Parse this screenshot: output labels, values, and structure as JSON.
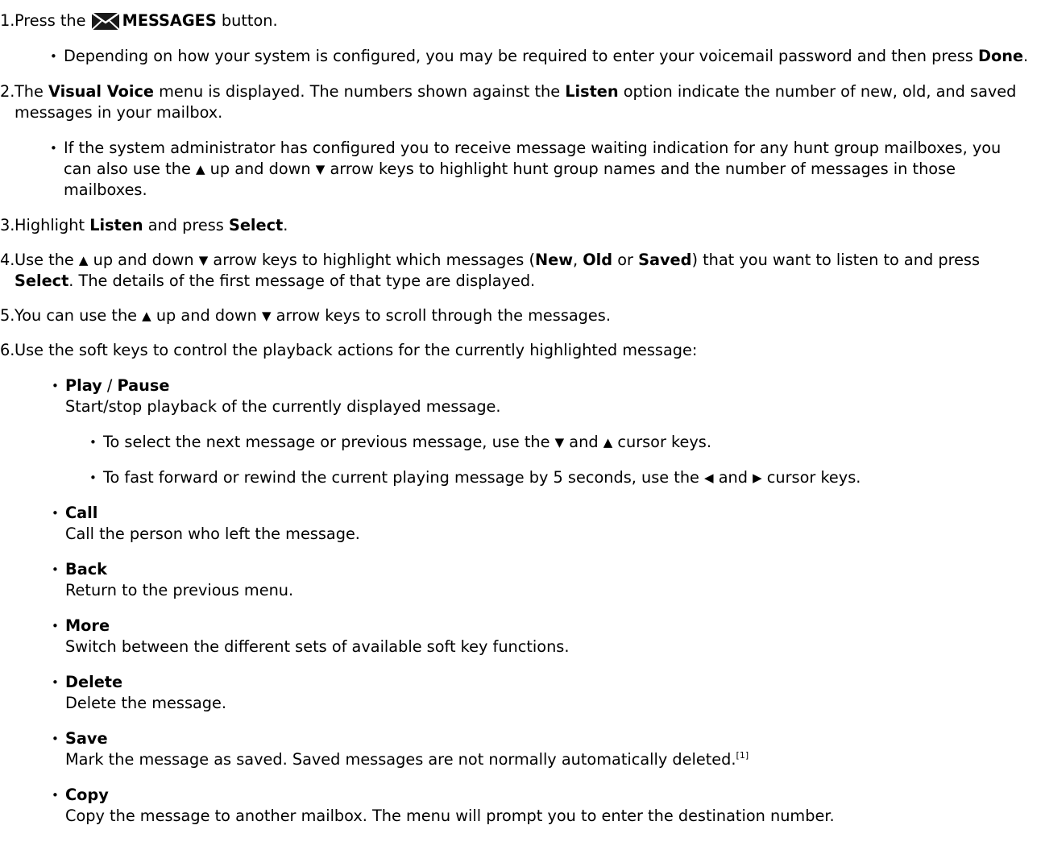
{
  "step1": {
    "num": "1.",
    "pre": "Press the ",
    "key": "MESSAGES",
    "post": " button.",
    "sub": {
      "pre": "Depending on how your system is configured, you may be required to enter your voicemail password and then press ",
      "key": "Done",
      "post": "."
    }
  },
  "step2": {
    "num": "2.",
    "a": "The ",
    "b": "Visual Voice",
    "c": " menu is displayed. The numbers shown against the ",
    "d": "Listen",
    "e": " option indicate the number of new, old, and saved messages in your mailbox.",
    "sub": {
      "a": "If the system administrator has configured you to receive message waiting indication for any hunt group mailboxes, you can also use the ",
      "b": " up and down ",
      "c": " arrow keys to highlight hunt group names and the number of messages in those mailboxes."
    }
  },
  "step3": {
    "num": "3.",
    "a": "Highlight ",
    "b": "Listen",
    "c": " and press ",
    "d": "Select",
    "e": "."
  },
  "step4": {
    "num": "4.",
    "a": "Use the ",
    "b": " up and down ",
    "c": " arrow keys to highlight which messages (",
    "d": "New",
    "e": ", ",
    "f": "Old",
    "g": " or ",
    "h": "Saved",
    "i": ") that you want to listen to and press ",
    "j": "Select",
    "k": ". The details of the first message of that type are displayed."
  },
  "step5": {
    "num": "5.",
    "a": "You can use the ",
    "b": " up and down ",
    "c": " arrow keys to scroll through the messages."
  },
  "step6": {
    "num": "6.",
    "text": "Use the soft keys to control the playback actions for the currently highlighted message:"
  },
  "options": {
    "play": {
      "t1": "Play",
      "sep": " / ",
      "t2": "Pause",
      "desc": "Start/stop playback of the currently displayed message.",
      "n1": {
        "a": "To select the next message or previous message, use the ",
        "b": " and ",
        "c": " cursor keys."
      },
      "n2": {
        "a": "To fast forward or rewind the current playing message by 5 seconds, use the ",
        "b": " and ",
        "c": " cursor keys."
      }
    },
    "call": {
      "title": "Call",
      "desc": "Call the person who left the message."
    },
    "back": {
      "title": "Back",
      "desc": "Return to the previous menu."
    },
    "more": {
      "title": "More",
      "desc": "Switch between the different sets of available soft key functions."
    },
    "delete": {
      "title": "Delete",
      "desc": "Delete the message."
    },
    "save": {
      "title": "Save",
      "desc": "Mark the message as saved. Saved messages are not normally automatically deleted.",
      "fn": "[1]"
    },
    "copy": {
      "title": "Copy",
      "desc": "Copy the message to another mailbox. The menu will prompt you to enter the destination number."
    }
  },
  "glyphs": {
    "up": "▲",
    "down": "▼",
    "left": "◀",
    "right": "▶"
  },
  "icons": {
    "messages": "envelope-icon"
  }
}
